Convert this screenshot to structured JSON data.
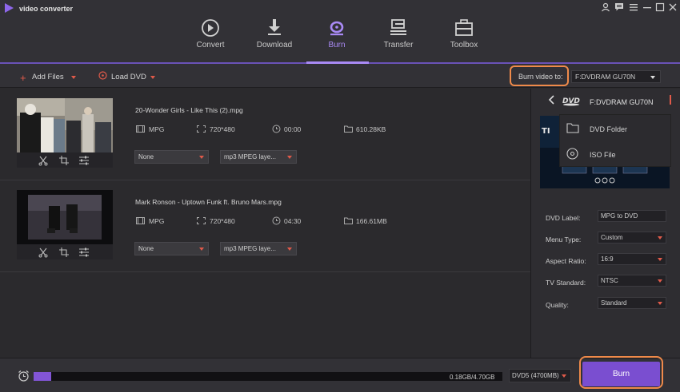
{
  "app": {
    "title": "video converter"
  },
  "nav": {
    "items": [
      {
        "label": "Convert",
        "icon": "convert-icon"
      },
      {
        "label": "Download",
        "icon": "download-icon"
      },
      {
        "label": "Burn",
        "icon": "burn-icon"
      },
      {
        "label": "Transfer",
        "icon": "transfer-icon"
      },
      {
        "label": "Toolbox",
        "icon": "toolbox-icon"
      }
    ],
    "active": "Burn"
  },
  "toolbar": {
    "add_files": "Add Files",
    "load_dvd": "Load DVD",
    "burn_to_label": "Burn video to:",
    "burn_to_value": "F:DVDRAM GU70N"
  },
  "files": [
    {
      "name": "20-Wonder Girls - Like This (2).mpg",
      "format": "MPG",
      "resolution": "720*480",
      "duration": "00:00",
      "size": "610.28KB",
      "subtitle": "None",
      "audio": "mp3 MPEG laye..."
    },
    {
      "name": "Mark Ronson - Uptown Funk ft. Bruno Mars.mpg",
      "format": "MPG",
      "resolution": "720*480",
      "duration": "04:30",
      "size": "166.61MB",
      "subtitle": "None",
      "audio": "mp3 MPEG laye..."
    }
  ],
  "panel": {
    "drive": "F:DVDRAM GU70N",
    "options": [
      "DVD Folder",
      "ISO File"
    ],
    "fields": [
      {
        "label": "DVD Label:",
        "value": "MPG to DVD",
        "select": false
      },
      {
        "label": "Menu Type:",
        "value": "Custom",
        "select": true
      },
      {
        "label": "Aspect Ratio:",
        "value": "16:9",
        "select": true
      },
      {
        "label": "TV Standard:",
        "value": "NTSC",
        "select": true
      },
      {
        "label": "Quality:",
        "value": "Standard",
        "select": true
      }
    ]
  },
  "bottom": {
    "progress_text": "0.18GB/4.70GB",
    "progress_fraction": 0.038,
    "disc_type": "DVD5 (4700MB)",
    "burn_button": "Burn"
  },
  "colors": {
    "accent": "#8255d6",
    "highlight": "#ef8a4a",
    "caret": "#e05a4a"
  }
}
